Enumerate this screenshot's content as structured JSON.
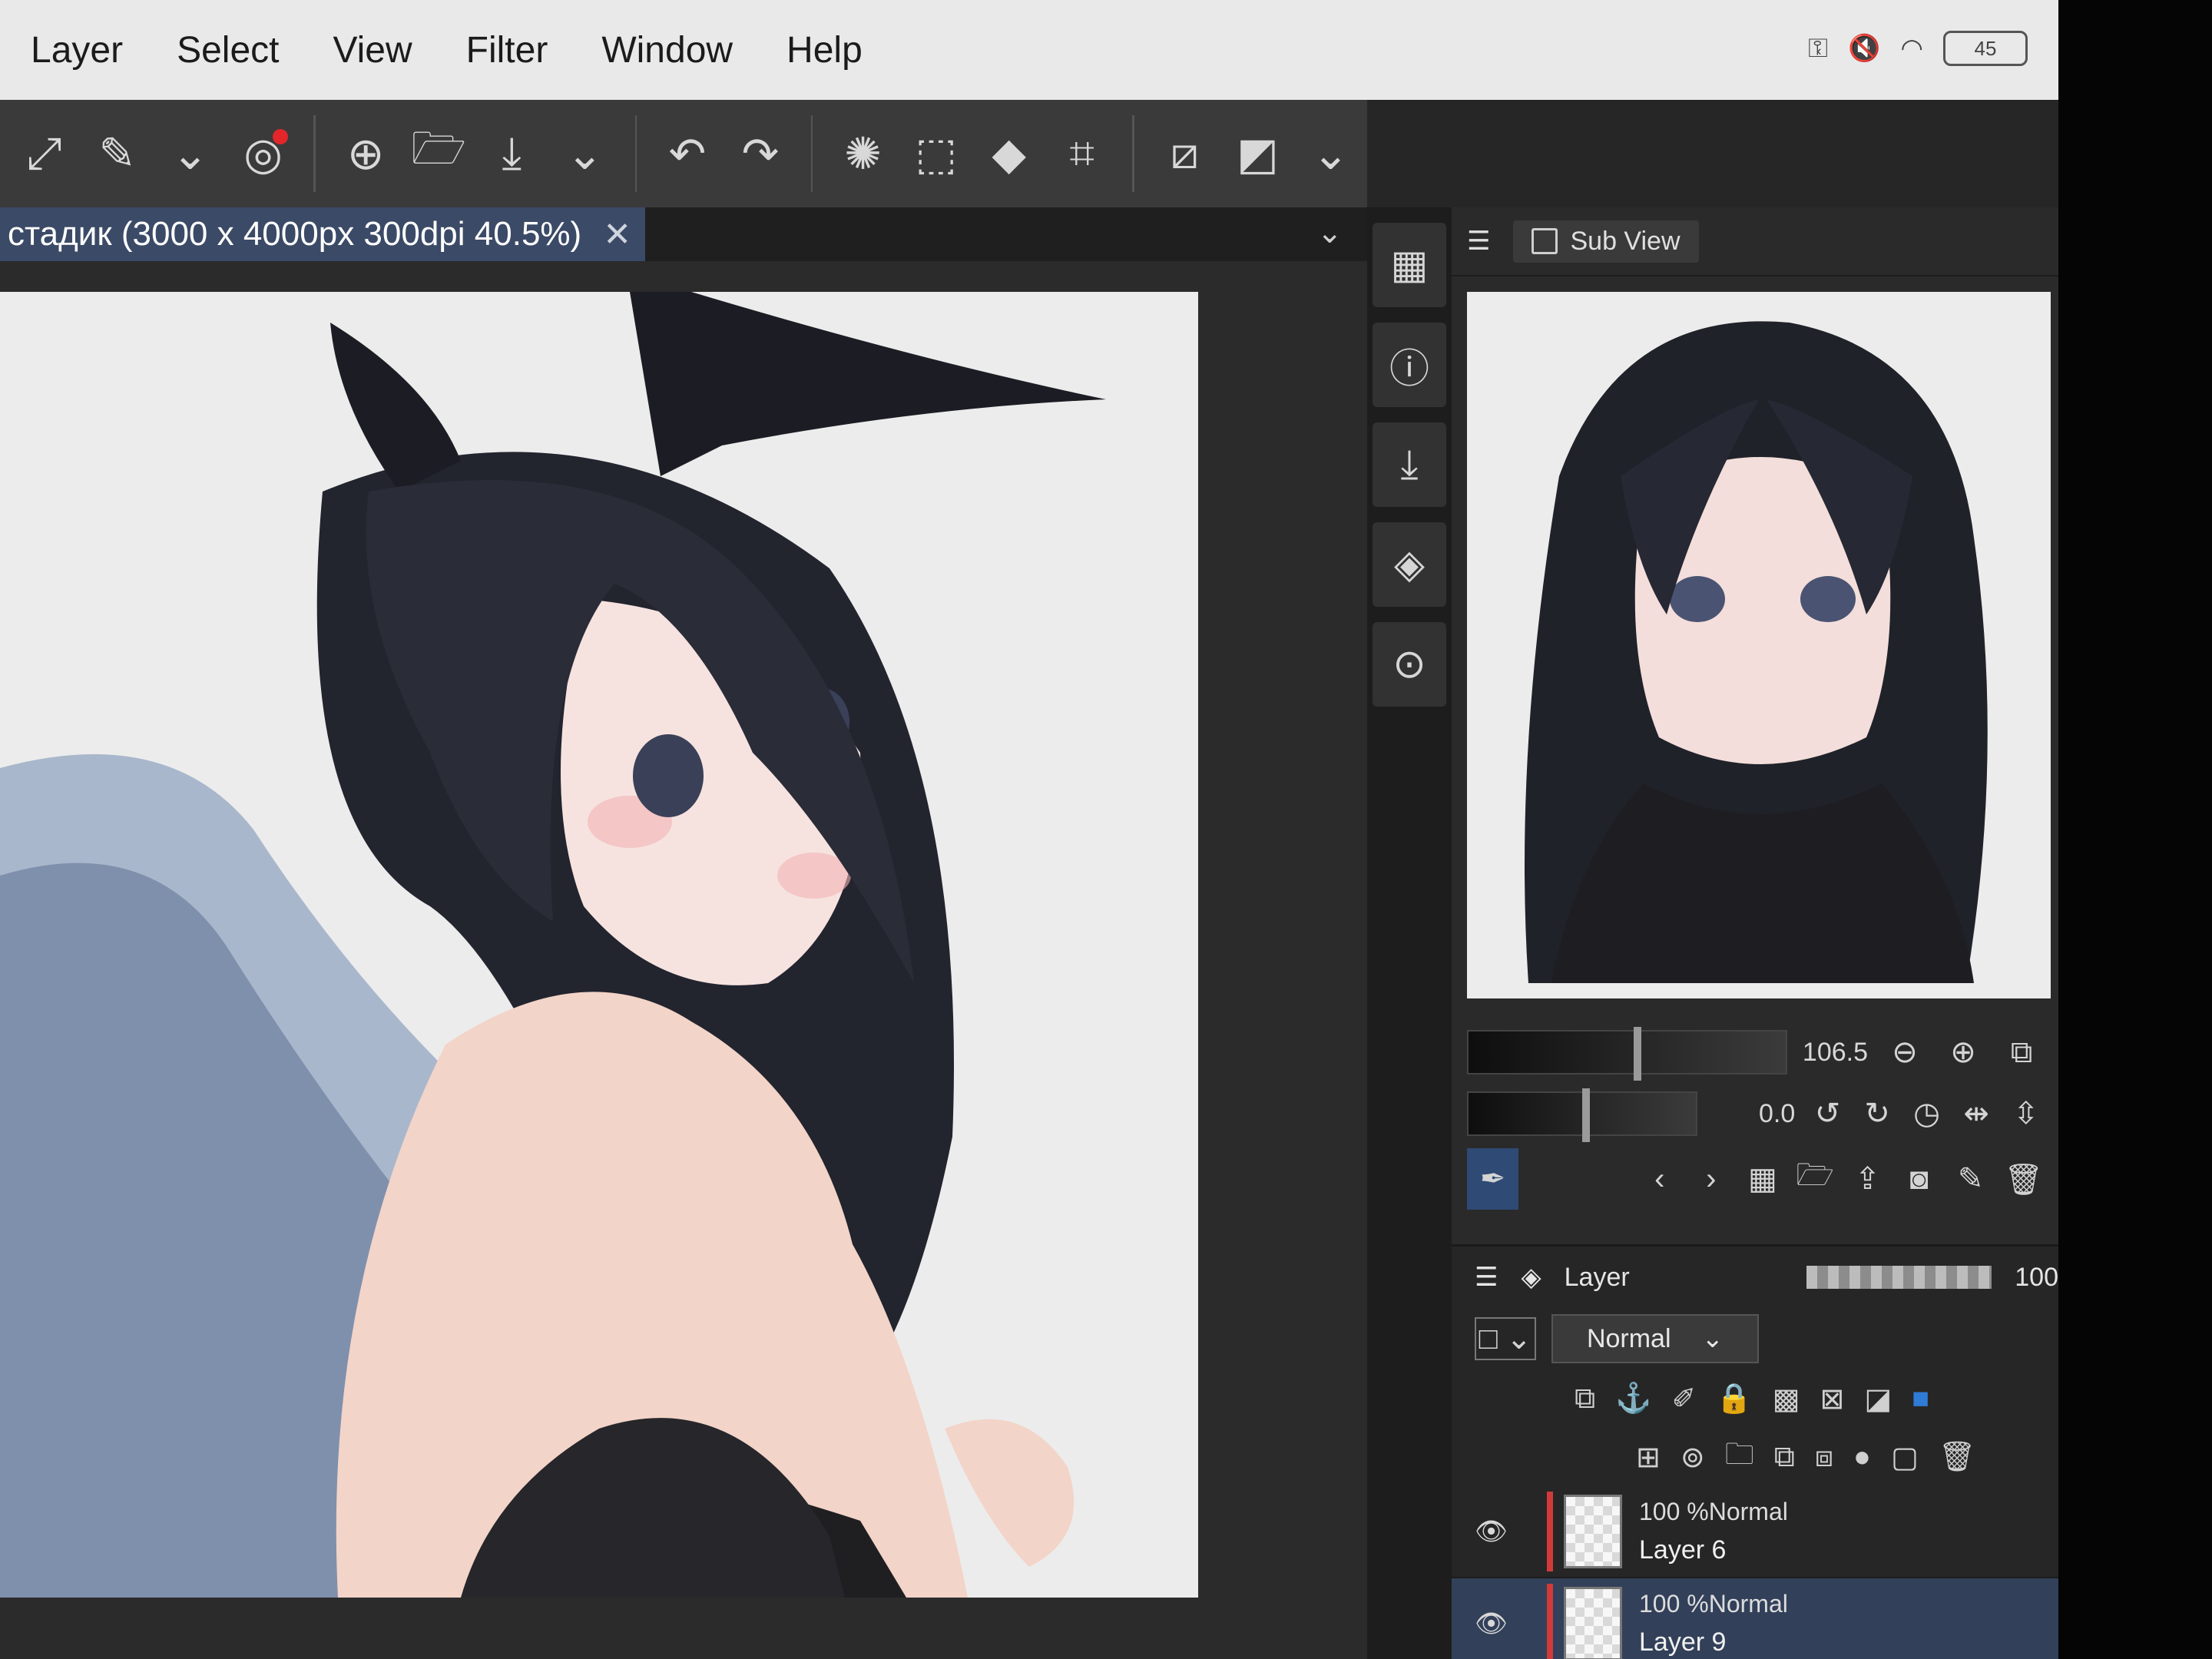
{
  "menu": [
    "Layer",
    "Select",
    "View",
    "Filter",
    "Window",
    "Help"
  ],
  "status": {
    "battery": "45"
  },
  "toolbar": {
    "icons": [
      "resize-icon",
      "edit-icon",
      "chevron-down-icon",
      "record-icon",
      "new-canvas-icon",
      "open-folder-icon",
      "save-icon",
      "chevron-down-icon",
      "undo-icon",
      "redo-icon",
      "loading-icon",
      "select-icon",
      "fill-icon",
      "transform-icon",
      "clear-selection-icon",
      "invert-selection-icon",
      "chevron-down-icon"
    ]
  },
  "document": {
    "tab_title": "стадик (3000 x 4000px 300dpi 40.5%)"
  },
  "strip": [
    "grid-icon",
    "info-icon",
    "import-icon",
    "layers-icon",
    "search-icon"
  ],
  "subview": {
    "title": "Sub View"
  },
  "navigator": {
    "zoom": "106.5",
    "rotation": "0.0"
  },
  "layer_panel": {
    "title": "Layer",
    "opacity": "100",
    "blend_mode": "Normal",
    "layers": [
      {
        "mode": "100 %Normal",
        "name": "Layer 6",
        "selected": false
      },
      {
        "mode": "100 %Normal",
        "name": "Layer 9",
        "selected": true
      }
    ]
  }
}
